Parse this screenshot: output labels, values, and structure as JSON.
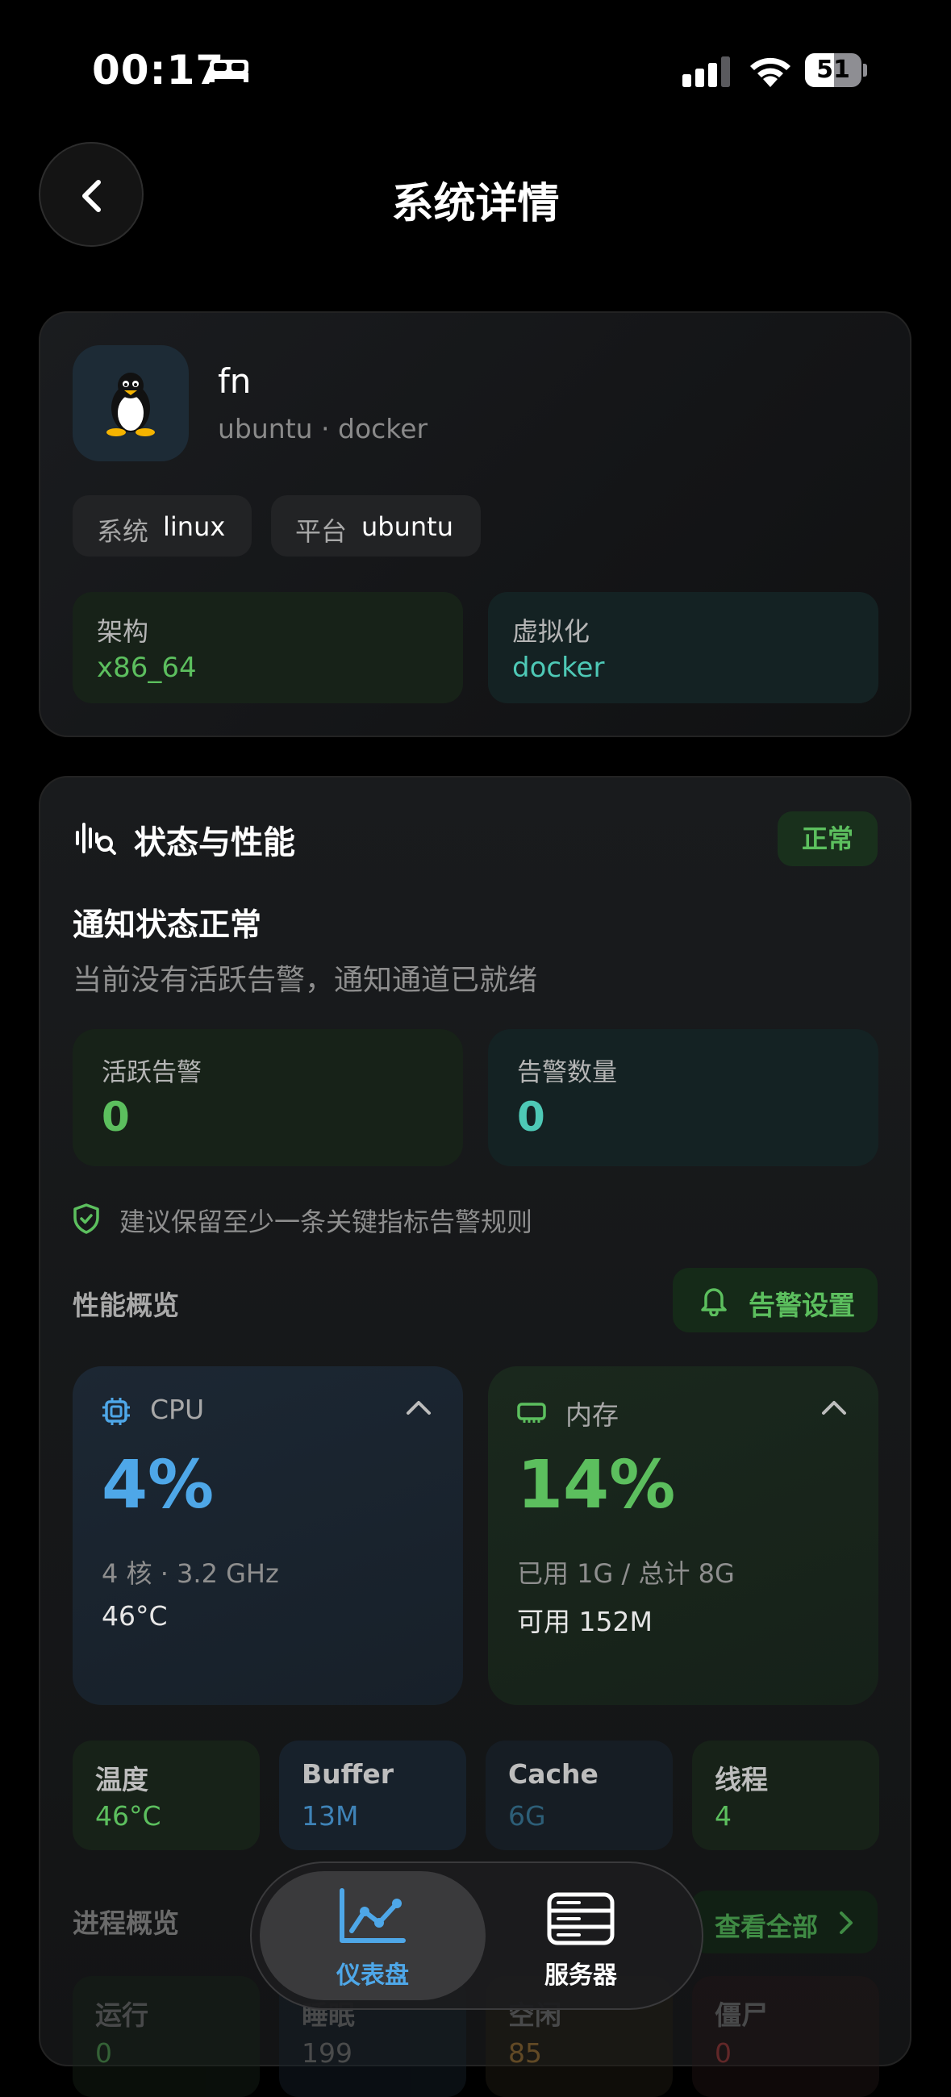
{
  "status_bar": {
    "time": "00:17",
    "battery": "51",
    "battery_level": 0.51
  },
  "header": {
    "title": "系统详情"
  },
  "system": {
    "host": "fn",
    "subtitle": "ubuntu · docker",
    "chips": [
      {
        "key": "系统",
        "value": "linux"
      },
      {
        "key": "平台",
        "value": "ubuntu"
      }
    ],
    "arch": {
      "key": "架构",
      "value": "x86_64"
    },
    "virt": {
      "key": "虚拟化",
      "value": "docker"
    }
  },
  "status": {
    "title": "状态与性能",
    "badge": "正常",
    "notice_title": "通知状态正常",
    "notice_sub": "当前没有活跃告警，通知通道已就绪",
    "active_alerts": {
      "key": "活跃告警",
      "value": "0"
    },
    "alert_count": {
      "key": "告警数量",
      "value": "0"
    },
    "tip": "建议保留至少一条关键指标告警规则",
    "perf_label": "性能概览",
    "alert_settings": "告警设置",
    "cpu": {
      "name": "CPU",
      "value": "4%",
      "sub": "4 核 · 3.2 GHz",
      "sub2": "46°C"
    },
    "mem": {
      "name": "内存",
      "value": "14%",
      "sub": "已用 1G / 总计 8G",
      "sub2": "可用 152M"
    },
    "mini": [
      {
        "key": "温度",
        "value": "46°C"
      },
      {
        "key": "Buffer",
        "value": "13M"
      },
      {
        "key": "Cache",
        "value": "6G"
      },
      {
        "key": "线程",
        "value": "4"
      }
    ],
    "process_label": "进程概览",
    "view_all": "查看全部",
    "processes": [
      {
        "key": "运行",
        "value": "0"
      },
      {
        "key": "睡眠",
        "value": "199"
      },
      {
        "key": "空闲",
        "value": "85"
      },
      {
        "key": "僵尸",
        "value": "0"
      }
    ]
  },
  "tabs": [
    {
      "label": "仪表盘",
      "active": true
    },
    {
      "label": "服务器",
      "active": false
    }
  ],
  "colors": {
    "green": "#5cbf5e",
    "teal": "#4ec9b6",
    "blue": "#4ea7e8"
  }
}
